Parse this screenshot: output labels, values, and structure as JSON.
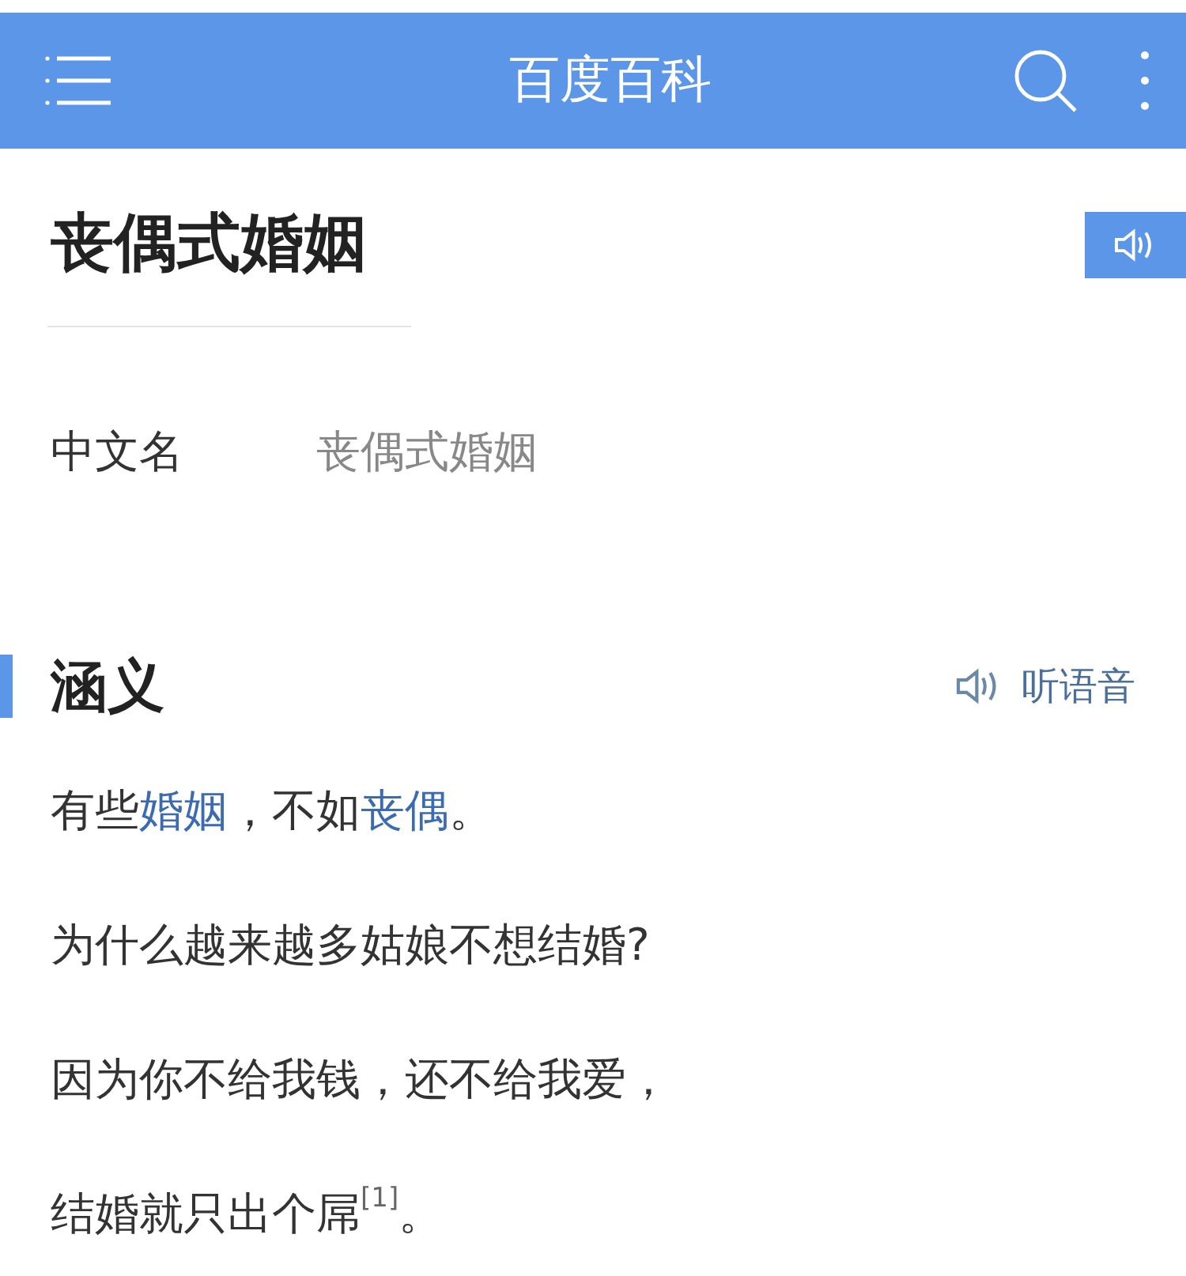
{
  "header": {
    "title": "百度百科"
  },
  "entry": {
    "title": "丧偶式婚姻"
  },
  "infobox": [
    {
      "label": "中文名",
      "value": "丧偶式婚姻"
    }
  ],
  "section": {
    "title": "涵义",
    "listen": "听语音"
  },
  "paragraphs": [
    [
      {
        "kind": "text",
        "text": "有些"
      },
      {
        "kind": "link",
        "text": "婚姻"
      },
      {
        "kind": "text",
        "text": "，不如"
      },
      {
        "kind": "link",
        "text": "丧偶"
      },
      {
        "kind": "text",
        "text": "。"
      }
    ],
    [
      {
        "kind": "text",
        "text": "为什么越来越多姑娘不想结婚?"
      }
    ],
    [
      {
        "kind": "text",
        "text": "因为你不给我钱，还不给我爱，"
      }
    ],
    [
      {
        "kind": "text",
        "text": "结婚就只出个屌"
      },
      {
        "kind": "ref",
        "text": "[1]"
      },
      {
        "kind": "text",
        "text": "。"
      }
    ]
  ]
}
